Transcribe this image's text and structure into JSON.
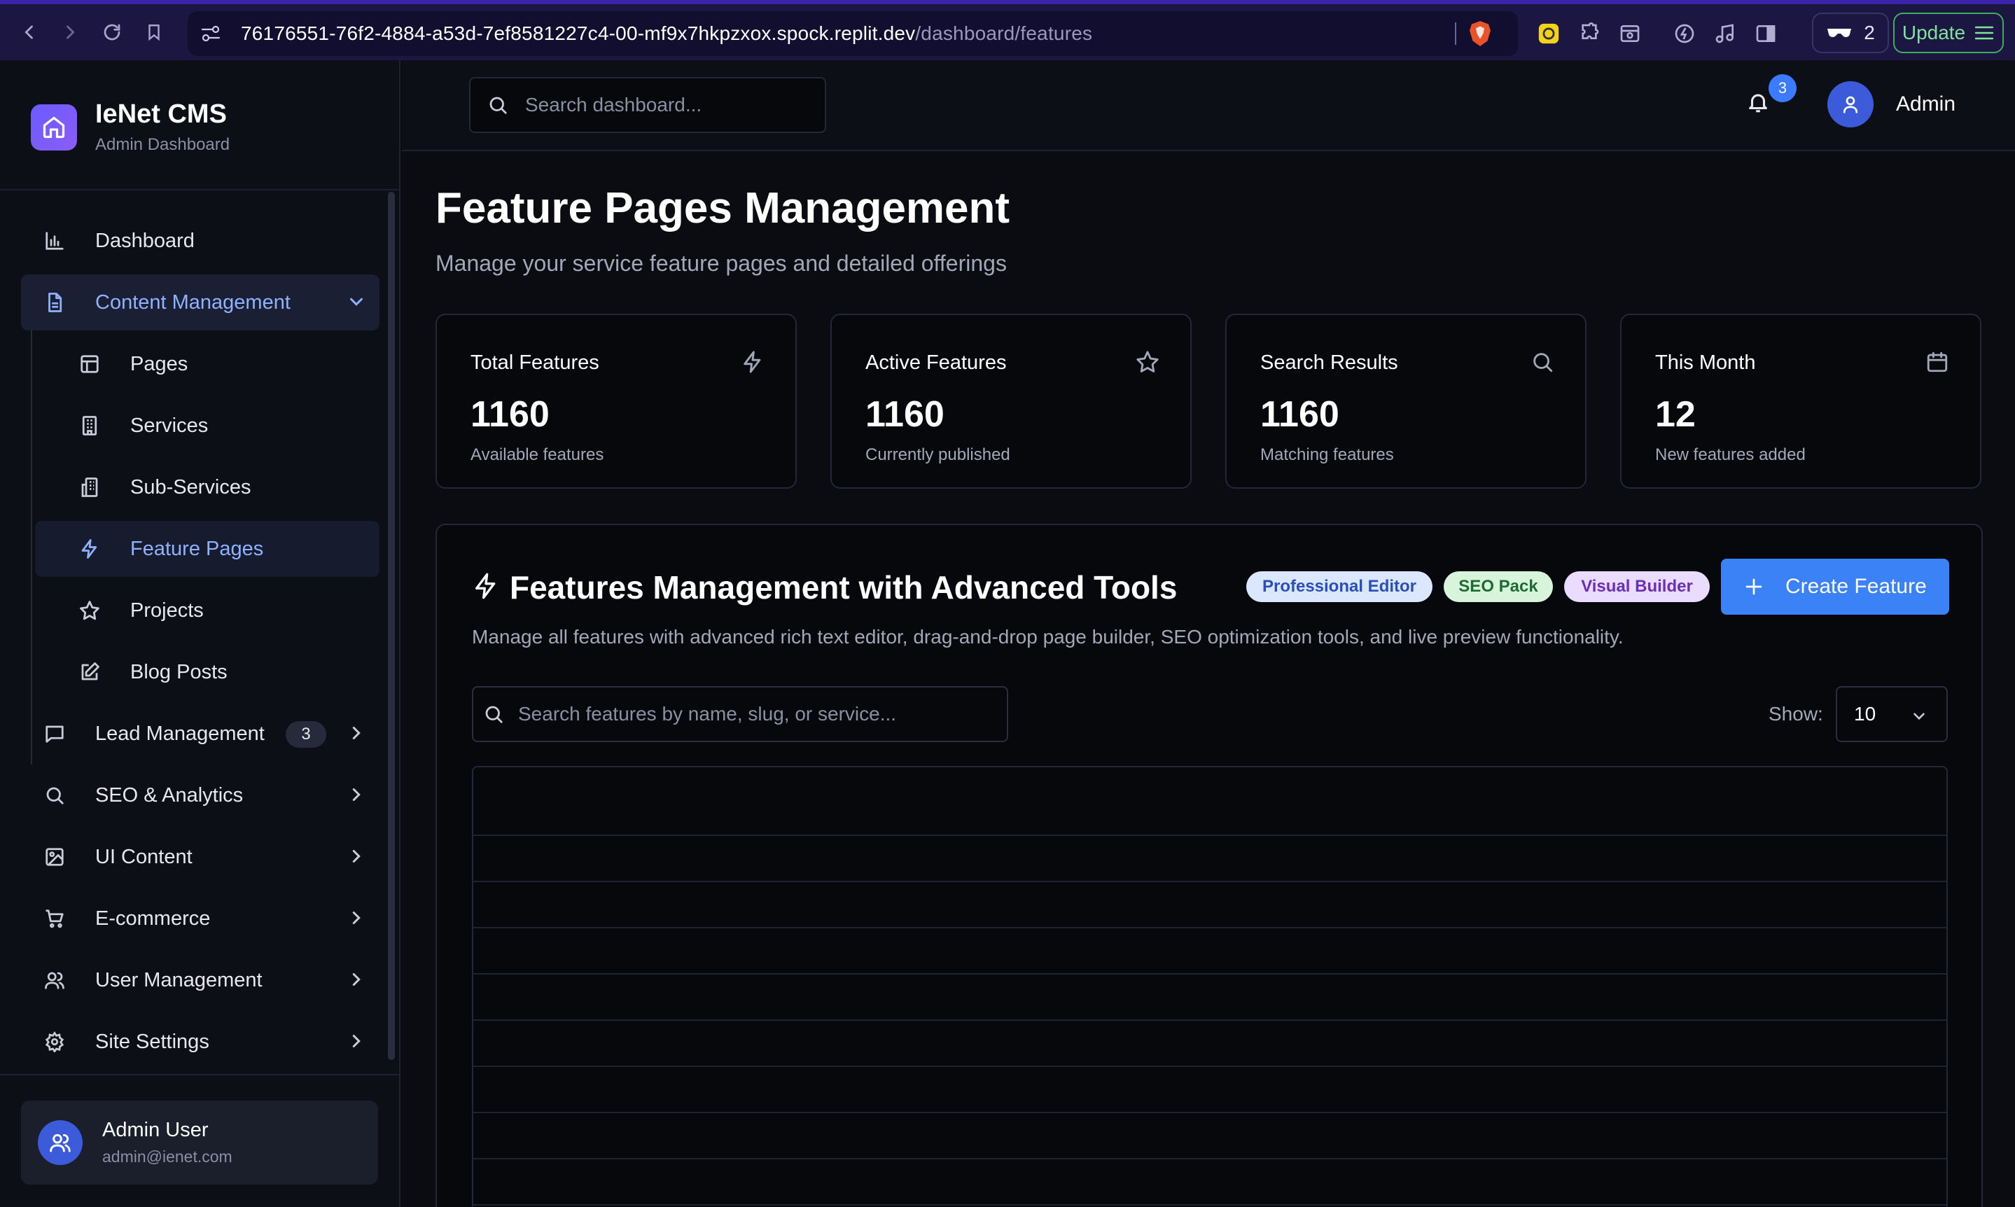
{
  "browser": {
    "url_host": "76176551-76f2-4884-a53d-7ef8581227c4-00-mf9x7hkpzxox.spock.replit.dev",
    "url_path": "/dashboard/features",
    "wallet_count": "2",
    "update_label": "Update"
  },
  "sidebar": {
    "brand_name": "IeNet CMS",
    "brand_sub": "Admin Dashboard",
    "items": [
      {
        "label": "Dashboard",
        "icon": "bar-chart-icon"
      },
      {
        "label": "Content Management",
        "icon": "file-text-icon"
      },
      {
        "label": "Lead Management",
        "icon": "message-square-icon",
        "badge": "3"
      },
      {
        "label": "SEO & Analytics",
        "icon": "search-icon"
      },
      {
        "label": "UI Content",
        "icon": "image-icon"
      },
      {
        "label": "E-commerce",
        "icon": "cart-icon"
      },
      {
        "label": "User Management",
        "icon": "users-icon"
      },
      {
        "label": "Site Settings",
        "icon": "gear-icon"
      }
    ],
    "sub_items": [
      {
        "label": "Pages",
        "icon": "layout-icon"
      },
      {
        "label": "Services",
        "icon": "building-icon"
      },
      {
        "label": "Sub-Services",
        "icon": "buildings-icon"
      },
      {
        "label": "Feature Pages",
        "icon": "zap-icon"
      },
      {
        "label": "Projects",
        "icon": "star-icon"
      },
      {
        "label": "Blog Posts",
        "icon": "edit-icon"
      }
    ],
    "user": {
      "name": "Admin User",
      "email": "admin@ienet.com"
    }
  },
  "header": {
    "search_placeholder": "Search dashboard...",
    "notification_count": "3",
    "admin_label": "Admin"
  },
  "main": {
    "title": "Feature Pages Management",
    "subtitle": "Manage your service feature pages and detailed offerings",
    "stats": [
      {
        "label": "Total Features",
        "value": "1160",
        "desc": "Available features",
        "icon": "zap-icon"
      },
      {
        "label": "Active Features",
        "value": "1160",
        "desc": "Currently published",
        "icon": "star-icon"
      },
      {
        "label": "Search Results",
        "value": "1160",
        "desc": "Matching features",
        "icon": "search-icon"
      },
      {
        "label": "This Month",
        "value": "12",
        "desc": "New features added",
        "icon": "calendar-icon"
      }
    ],
    "panel": {
      "title": "Features Management with Advanced Tools",
      "tags": [
        "Professional Editor",
        "SEO Pack",
        "Visual Builder"
      ],
      "create_label": "Create Feature",
      "description": "Manage all features with advanced rich text editor, drag-and-drop page builder, SEO optimization tools, and live preview functionality.",
      "search_placeholder": "Search features by name, slug, or service...",
      "show_label": "Show:",
      "show_value": "10"
    }
  },
  "colors": {
    "accent": "#3b82f6",
    "active_text": "#8fb2ff",
    "background": "#0b0b12"
  }
}
